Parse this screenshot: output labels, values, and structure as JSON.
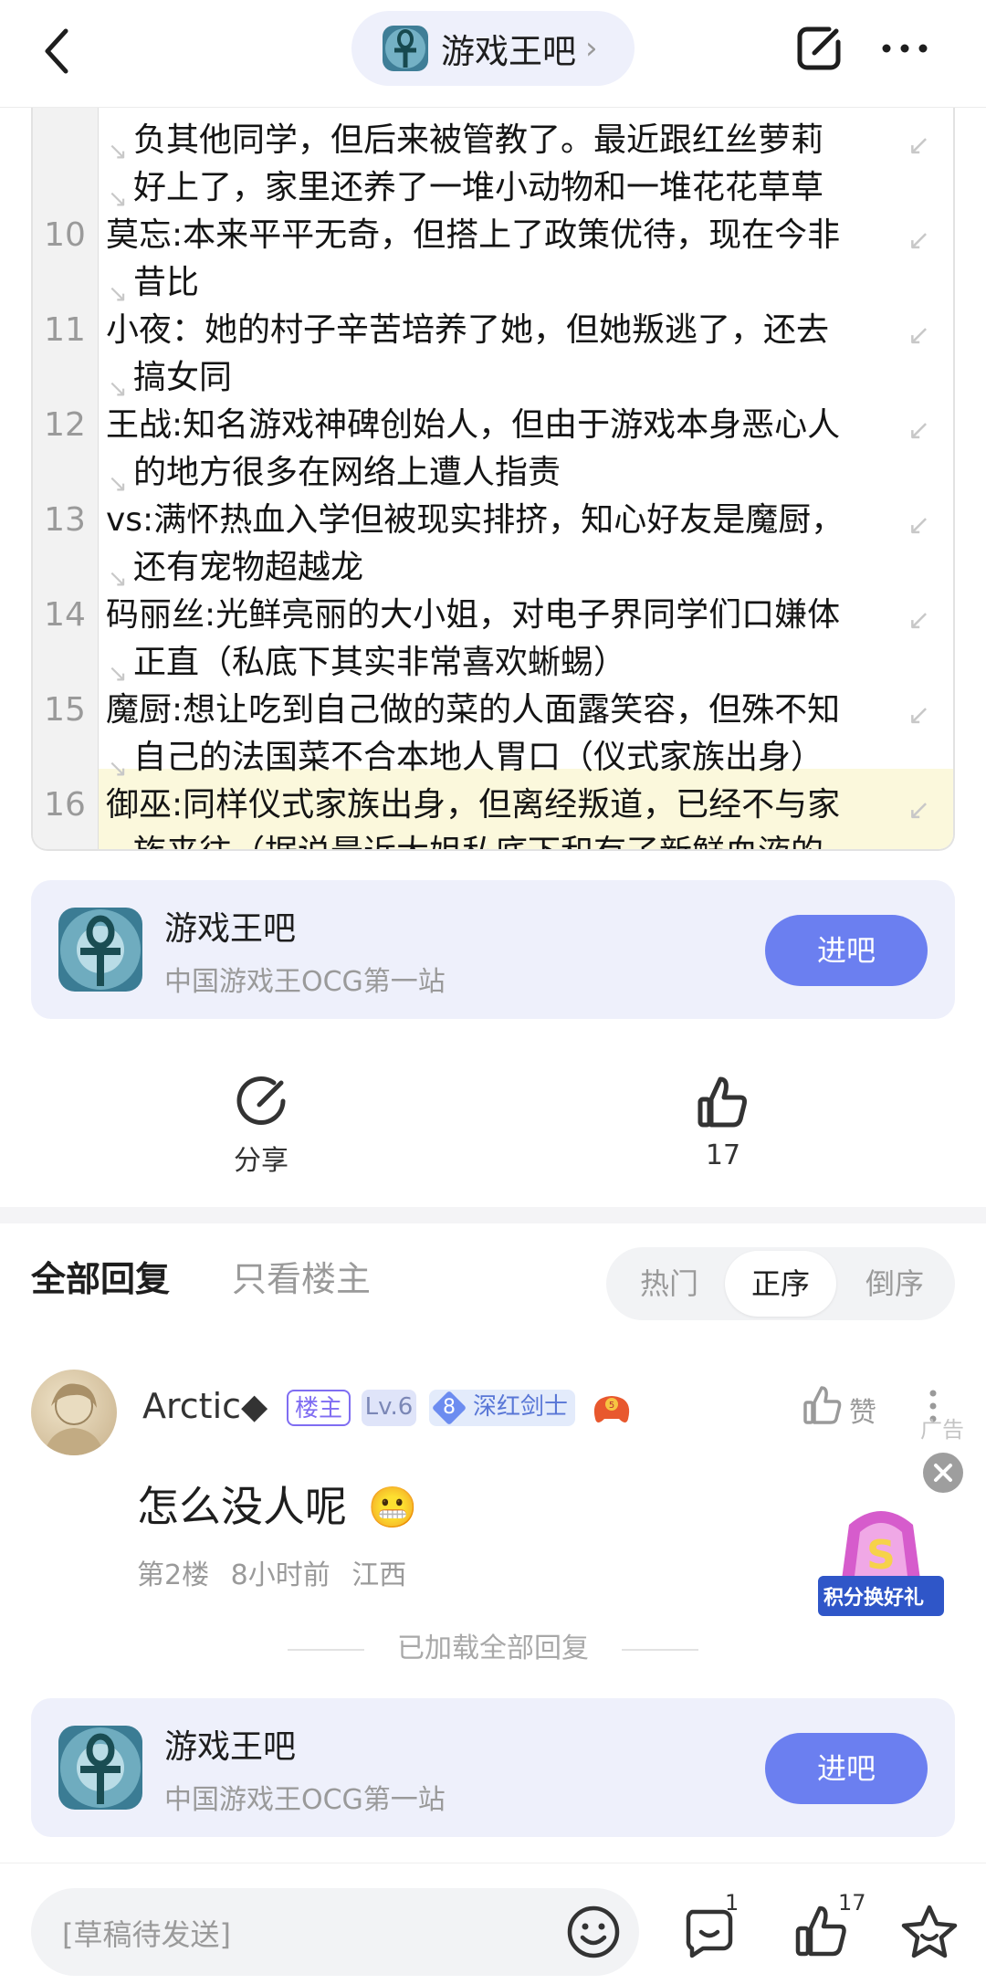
{
  "header": {
    "forum_name": "游戏王吧",
    "chevron": "›"
  },
  "code_lines": [
    {
      "num": "",
      "text": "负其他同学，但后来被管教了。最近跟红丝萝莉",
      "cont": true
    },
    {
      "num": "",
      "text": "好上了，家里还养了一堆小动物和一堆花花草草",
      "cont": true
    },
    {
      "num": "10",
      "text": "莫忘:本来平平无奇，但搭上了政策优待，现在今非",
      "cont": false
    },
    {
      "num": "",
      "text": "昔比",
      "cont": true
    },
    {
      "num": "11",
      "text": "小夜：她的村子辛苦培养了她，但她叛逃了，还去",
      "cont": false
    },
    {
      "num": "",
      "text": "搞女同",
      "cont": true
    },
    {
      "num": "12",
      "text": "王战:知名游戏神碑创始人，但由于游戏本身恶心人",
      "cont": false
    },
    {
      "num": "",
      "text": "的地方很多在网络上遭人指责",
      "cont": true
    },
    {
      "num": "13",
      "text": "vs:满怀热血入学但被现实排挤，知心好友是魔厨，",
      "cont": false
    },
    {
      "num": "",
      "text": "还有宠物超越龙",
      "cont": true
    },
    {
      "num": "14",
      "text": "码丽丝:光鲜亮丽的大小姐，对电子界同学们口嫌体",
      "cont": false
    },
    {
      "num": "",
      "text": "正直（私底下其实非常喜欢蜥蜴）",
      "cont": true
    },
    {
      "num": "15",
      "text": "魔厨:想让吃到自己做的菜的人面露笑容，但殊不知",
      "cont": false
    },
    {
      "num": "",
      "text": "自己的法国菜不合本地人胃口（仪式家族出身）",
      "cont": true
    },
    {
      "num": "16",
      "text": "御巫:同样仪式家族出身，但离经叛道，已经不与家",
      "cont": false
    },
    {
      "num": "",
      "text": "族来往（据说最近大姐私底下和有了新鲜血液的",
      "cont": true
    }
  ],
  "forum_card": {
    "title": "游戏王吧",
    "subtitle": "中国游戏王OCG第一站",
    "enter_label": "进吧"
  },
  "actions": {
    "share_label": "分享",
    "like_count": "17"
  },
  "reply_tabs": {
    "all": "全部回复",
    "owner_only": "只看楼主"
  },
  "sort_options": {
    "hot": "热门",
    "asc": "正序",
    "desc": "倒序",
    "active": "正序"
  },
  "comment": {
    "username": "Arctic◆",
    "badge_owner": "楼主",
    "badge_level": "Lv.6",
    "badge_title_num": "8",
    "badge_title": "深红剑士",
    "text": "怎么没人呢",
    "emoji": "😬",
    "floor": "第2楼",
    "time": "8小时前",
    "location": "江西",
    "like_label": "赞",
    "ad_label": "广告"
  },
  "promo": {
    "label": "积分换好礼"
  },
  "loaded_text": "已加载全部回复",
  "bottom_bar": {
    "input_placeholder": "[草稿待发送]",
    "comment_count": "1",
    "like_count": "17"
  }
}
